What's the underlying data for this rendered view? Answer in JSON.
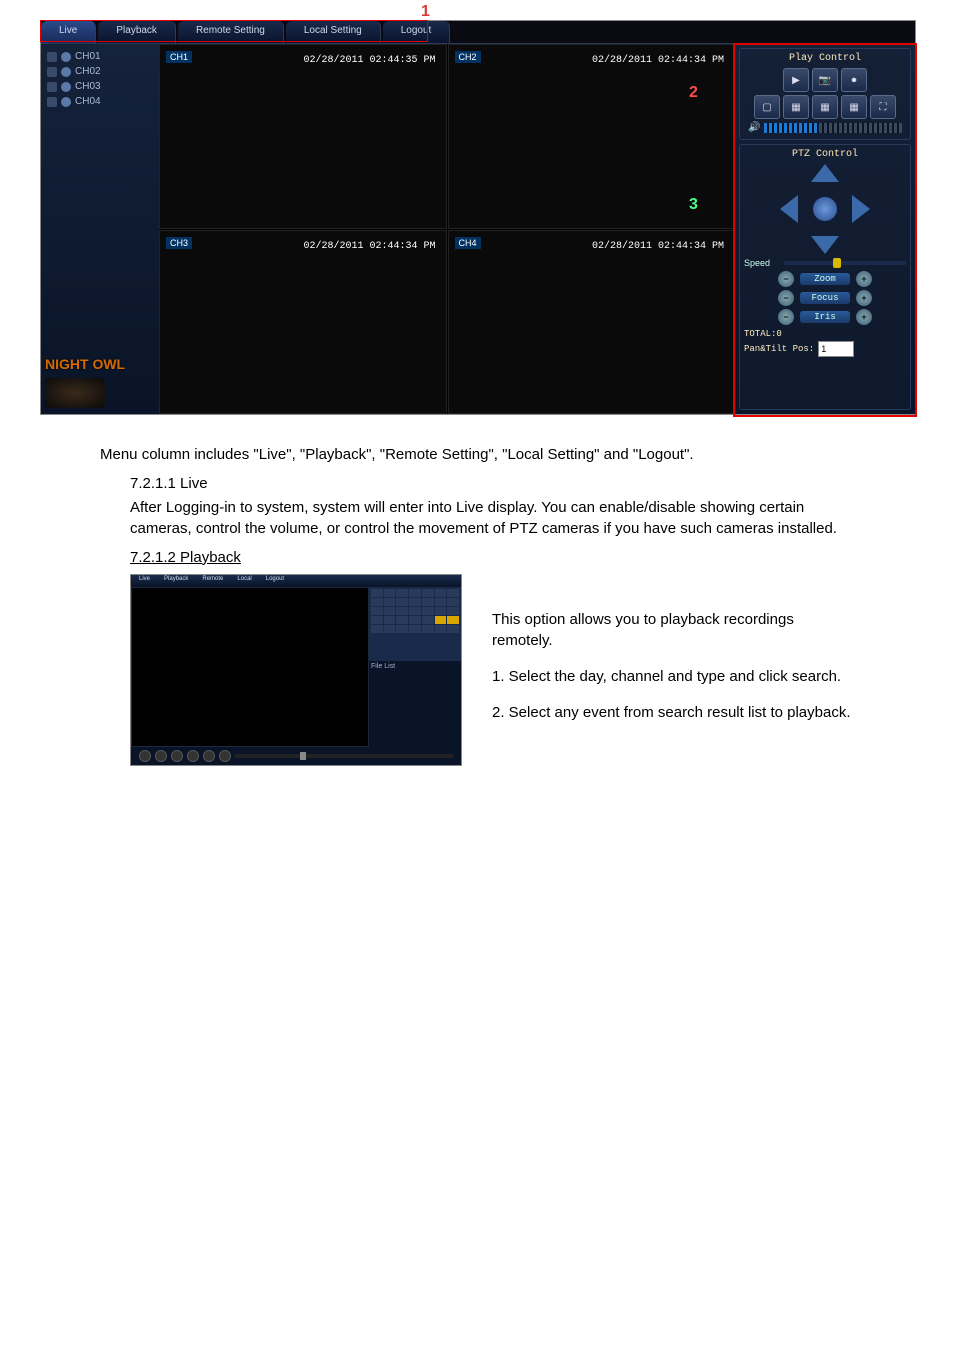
{
  "menu": {
    "tabs": [
      "Live",
      "Playback",
      "Remote Setting",
      "Local Setting",
      "Logout"
    ],
    "active": 0
  },
  "channels": [
    {
      "name": "CH01"
    },
    {
      "name": "CH02"
    },
    {
      "name": "CH03"
    },
    {
      "name": "CH04"
    }
  ],
  "logo_text": "NIGHT OWL",
  "cameras": [
    {
      "label": "CH1",
      "ts": "02/28/2011 02:44:35 PM"
    },
    {
      "label": "CH2",
      "ts": "02/28/2011 02:44:34 PM"
    },
    {
      "label": "CH3",
      "ts": "02/28/2011 02:44:34 PM"
    },
    {
      "label": "CH4",
      "ts": "02/28/2011 02:44:34 PM"
    }
  ],
  "markers": {
    "one": "1",
    "two": "2",
    "three": "3"
  },
  "play_panel": {
    "title": "Play Control"
  },
  "ptz_panel": {
    "title": "PTZ Control",
    "speed_label": "Speed",
    "zoom": "Zoom",
    "focus": "Focus",
    "iris": "Iris",
    "total": "TOTAL:0",
    "pantilt": "Pan&Tilt Pos:",
    "pantilt_val": "1"
  },
  "doc": {
    "menu_desc": "Menu column includes \"Live\", \"Playback\", \"Remote Setting\", \"Local Setting\" and \"Logout\".",
    "h_live": "7.2.1.1 Live",
    "live_p": "After Logging-in to system, system will enter into Live display. You can enable/disable showing certain cameras, control the volume, or control the movement of PTZ cameras if you have such cameras installed.",
    "h_pb": "7.2.1.2 Playback",
    "pb_p1": "This option allows you to playback recordings remotely.",
    "pb_p2": "1. Select the day, channel and type and click search.",
    "pb_p3": "2. Select any event from search result list to playback."
  },
  "pb_thumb": {
    "filelist_label": "File List"
  }
}
